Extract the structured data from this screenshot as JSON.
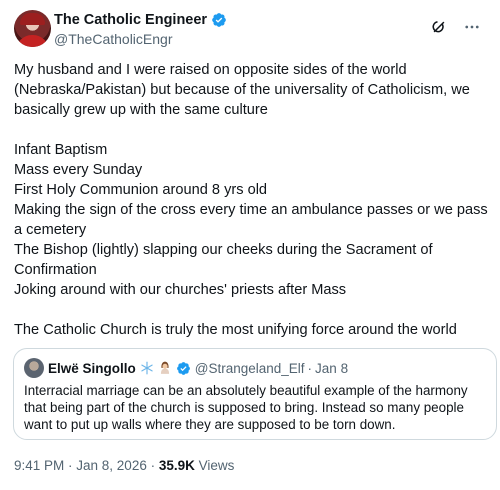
{
  "author": {
    "display_name": "The Catholic Engineer",
    "handle": "@TheCatholicEngr"
  },
  "icons": {
    "verified": "verified-badge-icon",
    "grok": "grok-icon",
    "more": "more-options-icon",
    "accent_blue": "#1d9bf0"
  },
  "tweet": {
    "text": "My husband and I were raised on opposite sides of the world (Nebraska/Pakistan) but because of the universality of Catholicism, we basically grew up with the same culture\n\nInfant Baptism\nMass every Sunday\nFirst Holy Communion around 8 yrs old\nMaking the sign of the cross every time an ambulance passes or we pass a cemetery\nThe Bishop (lightly) slapping our cheeks during the Sacrament of Confirmation\nJoking around with our churches' priests after Mass\n\nThe Catholic Church is truly the most unifying force around the world"
  },
  "quote": {
    "display_name": "Elwë Singollo",
    "emoji": [
      "snowflake-icon",
      "woman-icon"
    ],
    "handle": "@Strangeland_Elf",
    "separator": "·",
    "date": "Jan 8",
    "text": "Interracial marriage can be an absolutely beautiful example of the harmony that being part of the church is supposed to bring. Instead so many people want to put up walls where they are supposed to be torn down."
  },
  "meta": {
    "timestamp": "9:41 PM · Jan 8, 2026",
    "separator": " · ",
    "views_count": "35.9K",
    "views_label": " Views"
  }
}
